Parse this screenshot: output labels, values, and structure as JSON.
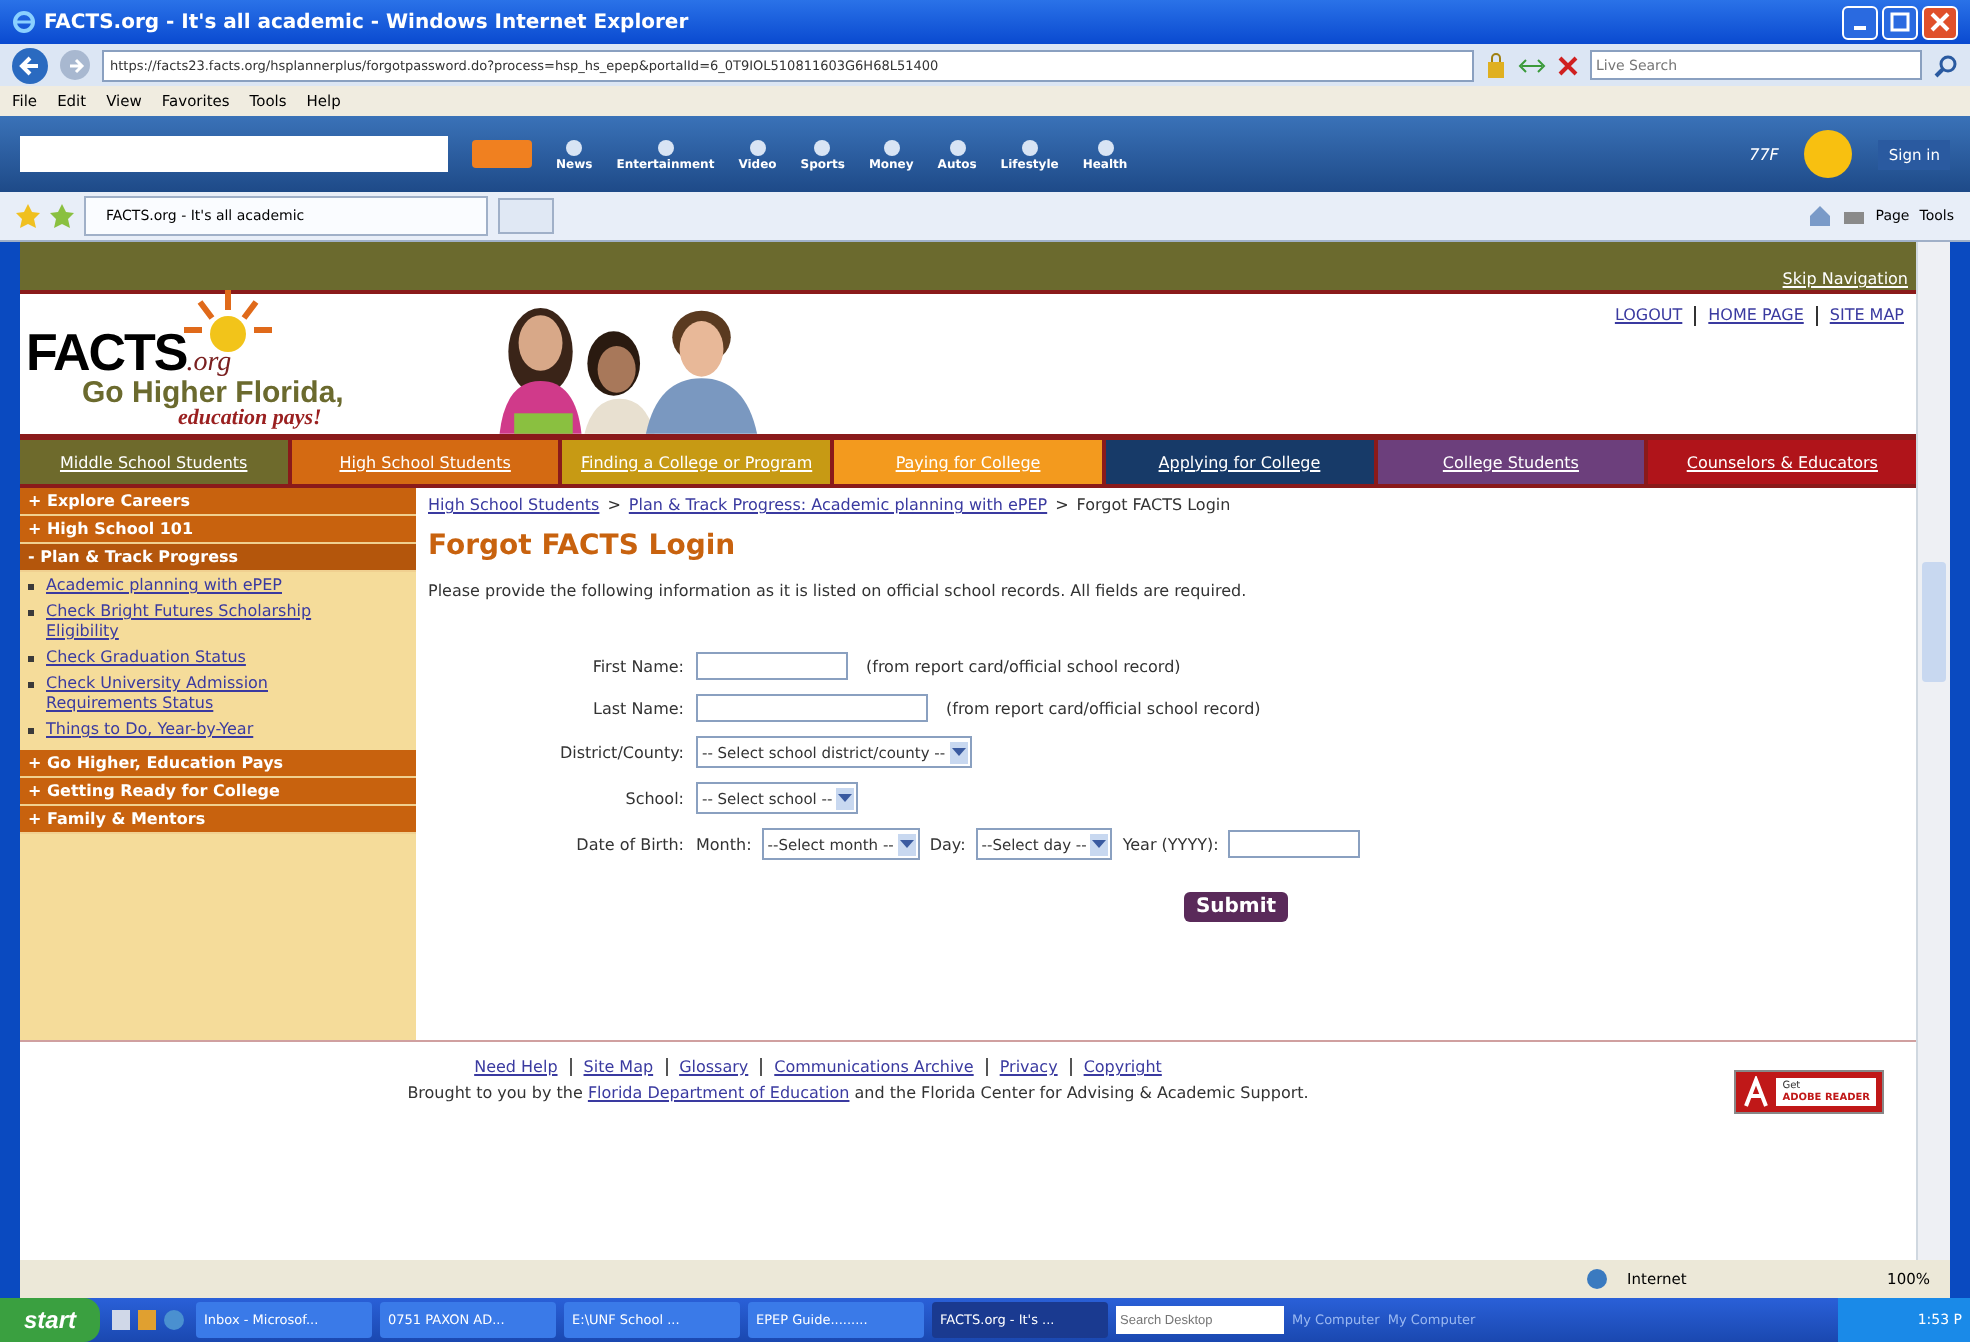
{
  "window": {
    "title": "FACTS.org - It's all academic - Windows Internet Explorer"
  },
  "address_bar": {
    "url": "https://facts23.facts.org/hsplannerplus/forgotpassword.do?process=hsp_hs_epep&portalId=6_0T9IOL510811603G6H68L51400",
    "search_placeholder": "Live Search"
  },
  "menu": [
    "File",
    "Edit",
    "View",
    "Favorites",
    "Tools",
    "Help"
  ],
  "toolbar": {
    "items": [
      "News",
      "Entertainment",
      "Video",
      "Sports",
      "Money",
      "Autos",
      "Lifestyle",
      "Health"
    ],
    "weather": "77F",
    "sign_in": "Sign in"
  },
  "tabs": [
    {
      "label": "FACTS.org - It's all academic",
      "selected": true
    }
  ],
  "command_bar": [
    "Page",
    "Tools"
  ],
  "page": {
    "skip_link": "Skip Navigation",
    "logo": {
      "name": "FACTS",
      "suffix": ".org",
      "tagline": "Go Higher Florida,",
      "slogan": "education pays!"
    },
    "top_links": [
      "LOGOUT",
      "HOME PAGE",
      "SITE MAP"
    ],
    "nav": [
      {
        "label": "Middle School Students",
        "color": "#6e6a2c"
      },
      {
        "label": "High School Students",
        "color": "#d46a12"
      },
      {
        "label": "Finding a College or Program",
        "color": "#c79a14"
      },
      {
        "label": "Paying for College",
        "color": "#f39a1e"
      },
      {
        "label": "Applying for College",
        "color": "#173a68"
      },
      {
        "label": "College Students",
        "color": "#6c3f7c"
      },
      {
        "label": "Counselors & Educators",
        "color": "#b0141a"
      }
    ],
    "sidebar": [
      {
        "label": "+ Explore Careers",
        "expanded": false
      },
      {
        "label": "+ High School 101",
        "expanded": false
      },
      {
        "label": "- Plan & Track Progress",
        "expanded": true,
        "children": [
          "Academic planning with ePEP",
          "Check Bright Futures Scholarship Eligibility",
          "Check Graduation Status",
          "Check University Admission Requirements Status",
          "Things to Do, Year-by-Year"
        ]
      },
      {
        "label": "+ Go Higher, Education Pays",
        "expanded": false
      },
      {
        "label": "+ Getting Ready for College",
        "expanded": false
      },
      {
        "label": "+ Family & Mentors",
        "expanded": false
      }
    ],
    "breadcrumb": {
      "links": [
        "High School Students",
        "Plan & Track Progress: Academic planning with ePEP"
      ],
      "separator": ">",
      "current": "Forgot FACTS Login"
    },
    "heading": "Forgot FACTS Login",
    "intro": "Please provide the following information as it is listed on official school records. All fields are required.",
    "form": [
      {
        "kind": "text",
        "label": "First Name:",
        "note": "(from report card/official school record)"
      },
      {
        "kind": "long_text",
        "label": "Last Name:",
        "note": "(from report card/official school record)"
      },
      {
        "kind": "select",
        "label": "District/County:",
        "value": "-- Select school district/county --"
      },
      {
        "kind": "select",
        "label": "School:",
        "value": "-- Select school --"
      },
      {
        "kind": "date",
        "label": "Date of Birth:",
        "parts": [
          {
            "kind": "select",
            "label": "Month:",
            "value": "--Select month --"
          },
          {
            "kind": "select",
            "label": "Day:",
            "value": "--Select day --"
          },
          {
            "kind": "text",
            "label": "Year (YYYY):"
          }
        ]
      }
    ],
    "submit": "Submit",
    "footer_links": [
      "Need Help",
      "Site Map",
      "Glossary",
      "Communications Archive",
      "Privacy",
      "Copyright"
    ],
    "credit": {
      "before": "Brought to you by the",
      "link": "Florida Department of Education",
      "after": "and the Florida Center for Advising & Academic Support."
    },
    "adobe": {
      "small": "Get",
      "brand": "ADOBE READER"
    }
  },
  "status_bar": {
    "zone": "Internet",
    "zoom": "100%"
  },
  "taskbar": {
    "start": "start",
    "buttons": [
      {
        "label": "Inbox - Microsof...",
        "selected": false
      },
      {
        "label": "0751 PAXON AD...",
        "selected": false
      },
      {
        "label": "E:\\UNF School ...",
        "selected": false
      },
      {
        "label": "EPEP Guide.........",
        "selected": false
      },
      {
        "label": "FACTS.org - It's ...",
        "selected": true
      }
    ],
    "search_placeholder": "Search Desktop",
    "toolbars": [
      "My Computer",
      "My Computer"
    ],
    "clock": "1:53 P"
  }
}
